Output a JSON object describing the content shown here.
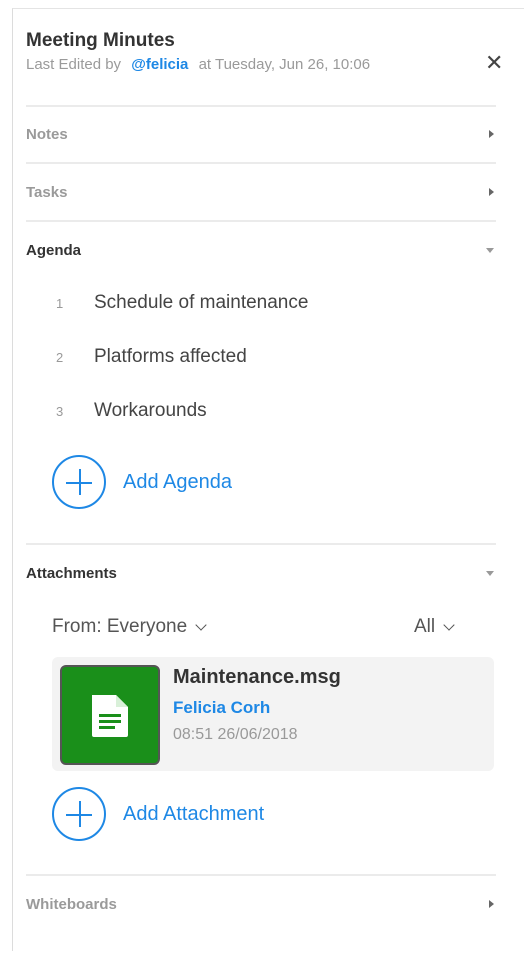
{
  "header": {
    "title": "Meeting Minutes",
    "edited_prefix": "Last Edited by",
    "edited_user": "@felicia",
    "edited_suffix": "at Tuesday, Jun 26, 10:06",
    "close_symbol": "✕"
  },
  "sections": {
    "notes": "Notes",
    "tasks": "Tasks",
    "agenda": "Agenda",
    "attachments": "Attachments",
    "whiteboards": "Whiteboards"
  },
  "agenda": {
    "items": [
      {
        "num": "1",
        "text": "Schedule of maintenance"
      },
      {
        "num": "2",
        "text": "Platforms affected"
      },
      {
        "num": "3",
        "text": "Workarounds"
      }
    ],
    "add_label": "Add Agenda"
  },
  "attachments": {
    "from_filter": "From: Everyone",
    "type_filter": "All",
    "files": [
      {
        "name": "Maintenance.msg",
        "owner": "Felicia Corh",
        "time": "08:51 26/06/2018",
        "icon": "document-icon",
        "color": "#1a8f1a"
      }
    ],
    "add_label": "Add Attachment"
  },
  "colors": {
    "accent": "#1e88e5",
    "file_green": "#1a8f1a"
  }
}
